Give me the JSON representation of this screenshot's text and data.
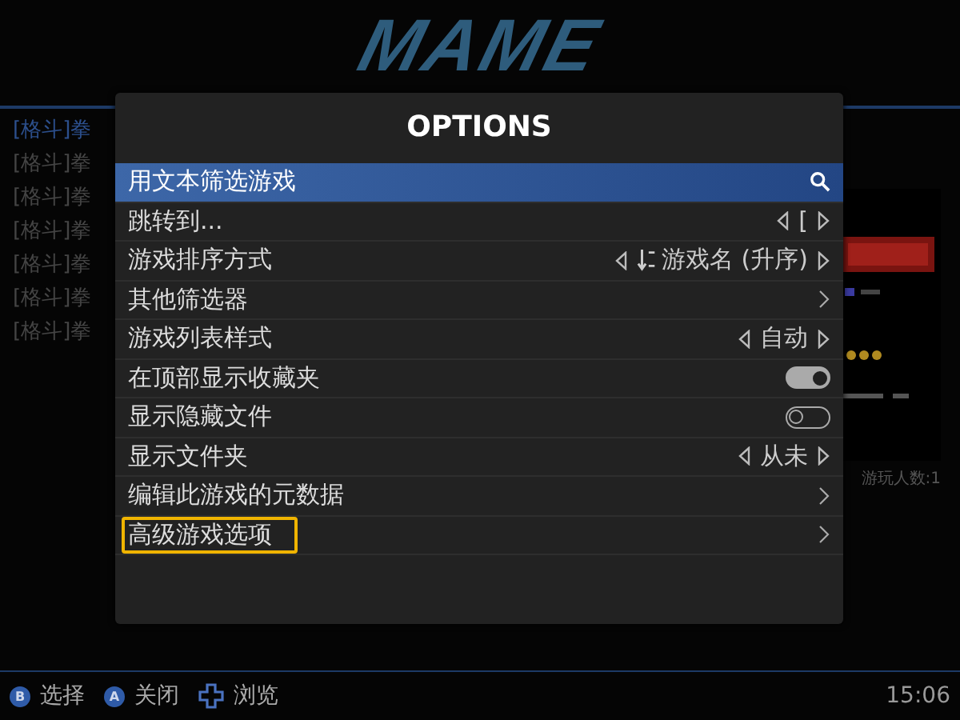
{
  "logo": "MAME",
  "game_list": [
    {
      "label": "[格斗]拳",
      "selected": true
    },
    {
      "label": "[格斗]拳",
      "selected": false
    },
    {
      "label": "[格斗]拳",
      "selected": false
    },
    {
      "label": "[格斗]拳",
      "selected": false
    },
    {
      "label": "[格斗]拳",
      "selected": false
    },
    {
      "label": "[格斗]拳",
      "selected": false
    },
    {
      "label": "[格斗]拳",
      "selected": false
    }
  ],
  "players": "游玩人数:1",
  "dialog": {
    "title": "OPTIONS",
    "items": [
      {
        "kind": "search",
        "label": "用文本筛选游戏",
        "selected": true,
        "focused": false
      },
      {
        "kind": "value",
        "label": "跳转到...",
        "value": "[",
        "selected": false,
        "focused": false
      },
      {
        "kind": "sort",
        "label": "游戏排序方式",
        "value": "游戏名 (升序)",
        "selected": false,
        "focused": false
      },
      {
        "kind": "submenu",
        "label": "其他筛选器",
        "selected": false,
        "focused": false
      },
      {
        "kind": "value",
        "label": "游戏列表样式",
        "value": "自动",
        "selected": false,
        "focused": false
      },
      {
        "kind": "toggle",
        "label": "在顶部显示收藏夹",
        "on": true,
        "selected": false,
        "focused": false
      },
      {
        "kind": "toggle",
        "label": "显示隐藏文件",
        "on": false,
        "selected": false,
        "focused": false
      },
      {
        "kind": "value",
        "label": "显示文件夹",
        "value": "从未",
        "selected": false,
        "focused": false
      },
      {
        "kind": "submenu",
        "label": "编辑此游戏的元数据",
        "selected": false,
        "focused": false
      },
      {
        "kind": "submenu",
        "label": "高级游戏选项",
        "selected": false,
        "focused": true
      }
    ]
  },
  "help": [
    {
      "kind": "button",
      "button": "B",
      "label": "选择"
    },
    {
      "kind": "button",
      "button": "A",
      "label": "关闭"
    },
    {
      "kind": "dpad",
      "label": "浏览"
    }
  ],
  "clock": "15:06"
}
